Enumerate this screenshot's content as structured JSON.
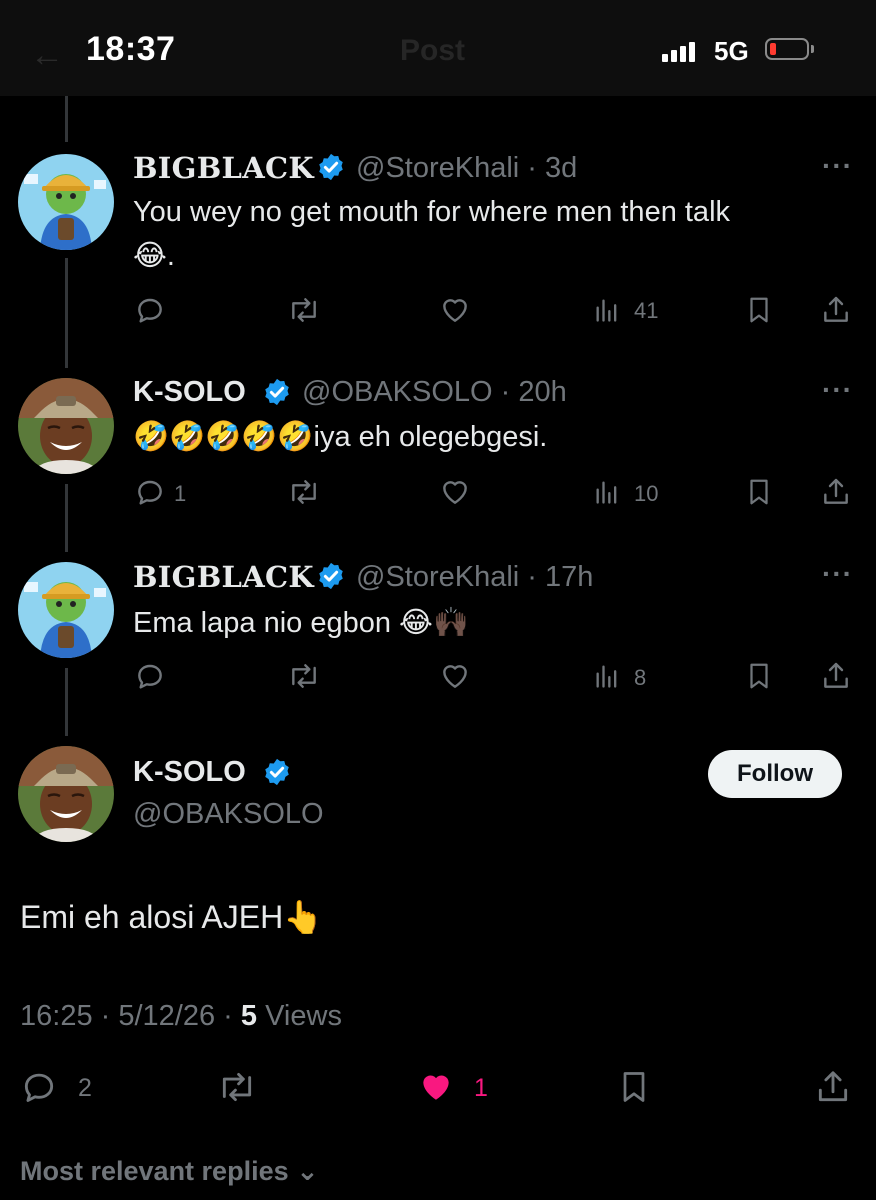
{
  "status_bar": {
    "time": "18:37",
    "network": "5G",
    "ghost_title": "Post"
  },
  "replies": [
    {
      "name": "BIGBLACK",
      "handle": "@StoreKhali",
      "time": "3d",
      "text_line1": "You wey no get mouth for where men then talk",
      "text_line2": ".",
      "views": "41",
      "replies_count": ""
    },
    {
      "name": "K-SOLO",
      "handle": "@OBAKSOLO",
      "time": "20h",
      "text": "iya eh olegebgesi.",
      "replies_count": "1",
      "views": "10"
    },
    {
      "name": "BIGBLACK",
      "handle": "@StoreKhali",
      "time": "17h",
      "text": "Ema lapa nio egbon",
      "views": "8"
    }
  ],
  "main_post": {
    "name": "K-SOLO",
    "handle": "@OBAKSOLO",
    "follow_label": "Follow",
    "text": "Emi eh alosi AJEH",
    "time": "16:25",
    "date": "5/12/26",
    "views_count": "5",
    "views_label": "Views",
    "replies_count": "2",
    "likes_count": "1",
    "like_color": "#f91880"
  },
  "sort_label": "Most relevant replies",
  "colors": {
    "accent": "#1d9bf0",
    "muted": "#71767b",
    "text": "#e7e9ea",
    "like": "#f91880"
  }
}
